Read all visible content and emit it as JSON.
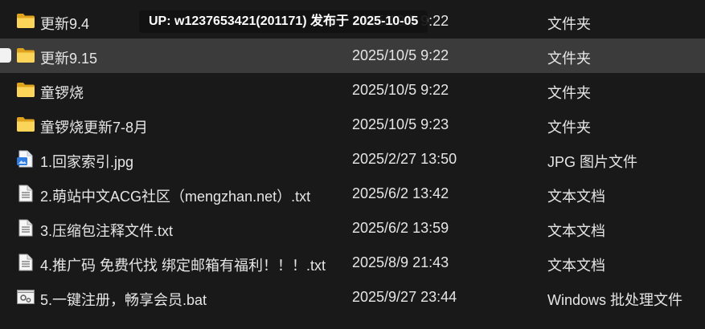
{
  "watermark": "UP: w1237653421(201171) 发布于 2025-10-05",
  "files": [
    {
      "name": "更新9.4",
      "date": "2025/10/5 9:22",
      "type": "文件夹",
      "icon": "folder-icon"
    },
    {
      "name": "更新9.15",
      "date": "2025/10/5 9:22",
      "type": "文件夹",
      "icon": "folder-icon",
      "selected": true
    },
    {
      "name": "童锣烧",
      "date": "2025/10/5 9:22",
      "type": "文件夹",
      "icon": "folder-icon"
    },
    {
      "name": "童锣烧更新7-8月",
      "date": "2025/10/5 9:23",
      "type": "文件夹",
      "icon": "folder-icon"
    },
    {
      "name": "1.回家索引.jpg",
      "date": "2025/2/27 13:50",
      "type": "JPG 图片文件",
      "icon": "image-file-icon"
    },
    {
      "name": "2.萌站中文ACG社区（mengzhan.net）.txt",
      "date": "2025/6/2 13:42",
      "type": "文本文档",
      "icon": "text-file-icon"
    },
    {
      "name": "3.压缩包注释文件.txt",
      "date": "2025/6/2 13:59",
      "type": "文本文档",
      "icon": "text-file-icon"
    },
    {
      "name": "4.推广码 免费代找 绑定邮箱有福利！！！.txt",
      "date": "2025/8/9 21:43",
      "type": "文本文档",
      "icon": "text-file-icon"
    },
    {
      "name": "5.一键注册，畅享会员.bat",
      "date": "2025/9/27 23:44",
      "type": "Windows 批处理文件",
      "icon": "batch-file-icon"
    }
  ]
}
